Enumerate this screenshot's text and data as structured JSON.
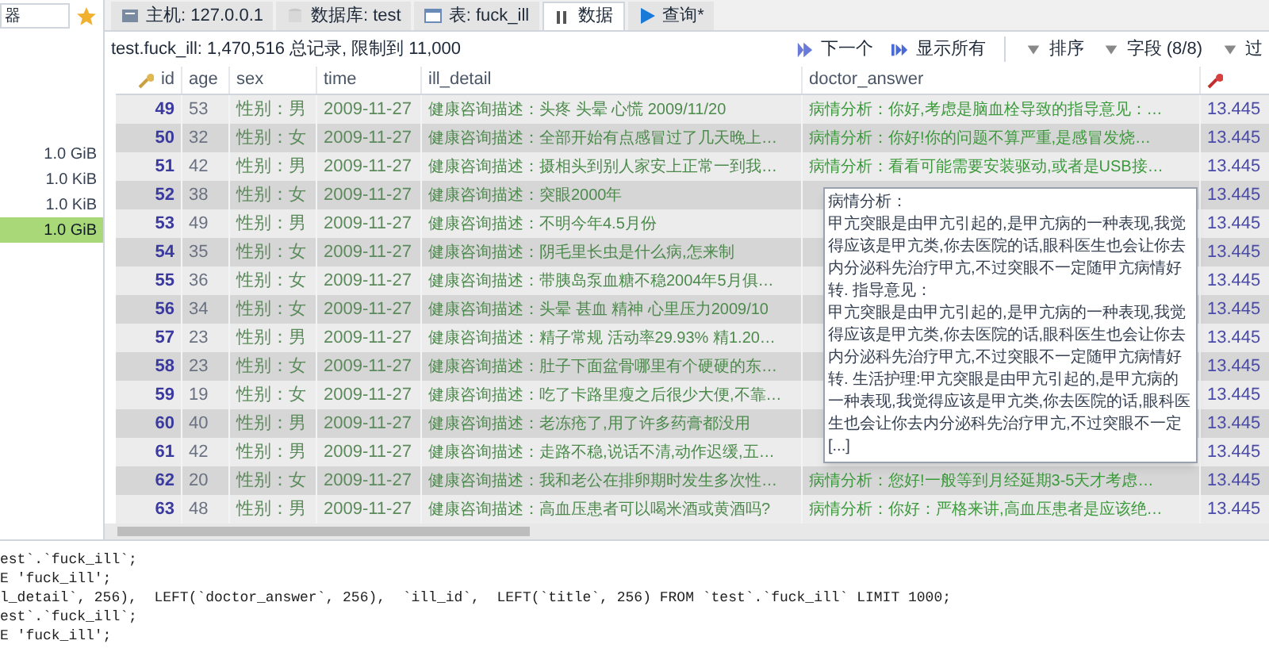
{
  "sidebar": {
    "filter_value": "器",
    "sizes": [
      {
        "text": "1.0 GiB",
        "selected": false
      },
      {
        "text": "1.0 KiB",
        "selected": false
      },
      {
        "text": "1.0 KiB",
        "selected": false
      },
      {
        "text": "1.0 GiB",
        "selected": true
      }
    ]
  },
  "tabs": [
    {
      "label": "主机: 127.0.0.1",
      "selected": false
    },
    {
      "label": "数据库: test",
      "selected": false
    },
    {
      "label": "表: fuck_ill",
      "selected": false
    },
    {
      "label": "数据",
      "selected": true
    },
    {
      "label": "查询*",
      "selected": false
    }
  ],
  "info": "test.fuck_ill: 1,470,516 总记录, 限制到 11,000",
  "toolbar": [
    {
      "label": "下一个"
    },
    {
      "label": "显示所有"
    },
    {
      "label": "排序"
    },
    {
      "label": "字段 (8/8)"
    },
    {
      "label": "过"
    }
  ],
  "table": {
    "columns": [
      "id",
      "age",
      "sex",
      "time",
      "ill_detail",
      "doctor_answer"
    ],
    "rows": [
      {
        "id": "49",
        "age": "53",
        "sex": "性别：男",
        "time": "2009-11-27",
        "ill_detail": "健康咨询描述：头疼 头晕 心慌 2009/11/20",
        "doctor_answer": "病情分析：你好,考虑是脑血栓导致的指导意见：…",
        "column_7": "13.445"
      },
      {
        "id": "50",
        "age": "32",
        "sex": "性别：女",
        "time": "2009-11-27",
        "ill_detail": "健康咨询描述：全部开始有点感冒过了几天晚上…",
        "doctor_answer": "病情分析：你好!你的问题不算严重,是感冒发烧…",
        "column_7": "13.445"
      },
      {
        "id": "51",
        "age": "42",
        "sex": "性别：男",
        "time": "2009-11-27",
        "ill_detail": "健康咨询描述：摄相头到别人家安上正常一到我…",
        "doctor_answer": "病情分析：看看可能需要安装驱动,或者是USB接…",
        "column_7": "13.445"
      },
      {
        "id": "52",
        "age": "38",
        "sex": "性别：女",
        "time": "2009-11-27",
        "ill_detail": "健康咨询描述：突眼2000年",
        "column_7": "13.445"
      },
      {
        "id": "53",
        "age": "49",
        "sex": "性别：男",
        "time": "2009-11-27",
        "ill_detail": "健康咨询描述：不明今年4.5月份",
        "column_7": "13.445"
      },
      {
        "id": "54",
        "age": "35",
        "sex": "性别：女",
        "time": "2009-11-27",
        "ill_detail": "健康咨询描述：阴毛里长虫是什么病,怎来制",
        "column_7": "13.445"
      },
      {
        "id": "55",
        "age": "36",
        "sex": "性别：女",
        "time": "2009-11-27",
        "ill_detail": "健康咨询描述：带胰岛泵血糖不稳2004年5月俱…",
        "column_7": "13.445"
      },
      {
        "id": "56",
        "age": "34",
        "sex": "性别：女",
        "time": "2009-11-27",
        "ill_detail": "健康咨询描述：头晕 甚血 精神 心里压力2009/10",
        "column_7": "13.445"
      },
      {
        "id": "57",
        "age": "23",
        "sex": "性别：男",
        "time": "2009-11-27",
        "ill_detail": "健康咨询描述：精子常规 活动率29.93% 精1.20…",
        "column_7": "13.445"
      },
      {
        "id": "58",
        "age": "23",
        "sex": "性别：女",
        "time": "2009-11-27",
        "ill_detail": "健康咨询描述：肚子下面盆骨哪里有个硬硬的东…",
        "column_7": "13.445"
      },
      {
        "id": "59",
        "age": "19",
        "sex": "性别：女",
        "time": "2009-11-27",
        "ill_detail": "健康咨询描述：吃了卡路里瘦之后很少大便,不靠…",
        "column_7": "13.445"
      },
      {
        "id": "60",
        "age": "40",
        "sex": "性别：男",
        "time": "2009-11-27",
        "ill_detail": "健康咨询描述：老冻疮了,用了许多药膏都没用",
        "column_7": "13.445"
      },
      {
        "id": "61",
        "age": "42",
        "sex": "性别：男",
        "time": "2009-11-27",
        "ill_detail": "健康咨询描述：走路不稳,说话不清,动作迟缓,五…",
        "column_7": "13.445"
      },
      {
        "id": "62",
        "age": "20",
        "sex": "性别：女",
        "time": "2009-11-27",
        "ill_detail": "健康咨询描述：我和老公在排卵期时发生多次性…",
        "doctor_answer": "病情分析：您好!一般等到月经延期3-5天才考虑…",
        "column_7": "13.445"
      },
      {
        "id": "63",
        "age": "48",
        "sex": "性别：男",
        "time": "2009-11-27",
        "ill_detail": "健康咨询描述：高血压患者可以喝米酒或黄酒吗?",
        "doctor_answer": "病情分析：你好：严格来讲,高血压患者是应该绝…",
        "column_7": "13.445"
      }
    ]
  },
  "tooltip": {
    "lines": [
      "病情分析：",
      "甲亢突眼是由甲亢引起的,是甲亢病的一种表现,我觉",
      "得应该是甲亢类,你去医院的话,眼科医生也会让你去",
      "内分泌科先治疗甲亢,不过突眼不一定随甲亢病情好",
      "转. 指导意见：",
      "甲亢突眼是由甲亢引起的,是甲亢病的一种表现,我觉",
      "得应该是甲亢类,你去医院的话,眼科医生也会让你去",
      "内分泌科先治疗甲亢,不过突眼不一定随甲亢病情好",
      "转. 生活护理:甲亢突眼是由甲亢引起的,是甲亢病的",
      "一种表现,我觉得应该是甲亢类,你去医院的话,眼科医",
      "生也会让你去内分泌科先治疗甲亢,不过突眼不一定",
      "[...]"
    ]
  },
  "sql_log": [
    "est`.`fuck_ill`;",
    "E 'fuck_ill';",
    "l_detail`, 256),  LEFT(`doctor_answer`, 256),  `ill_id`,  LEFT(`title`, 256) FROM `test`.`fuck_ill` LIMIT 1000;",
    "est`.`fuck_ill`;",
    "E 'fuck_ill';"
  ]
}
